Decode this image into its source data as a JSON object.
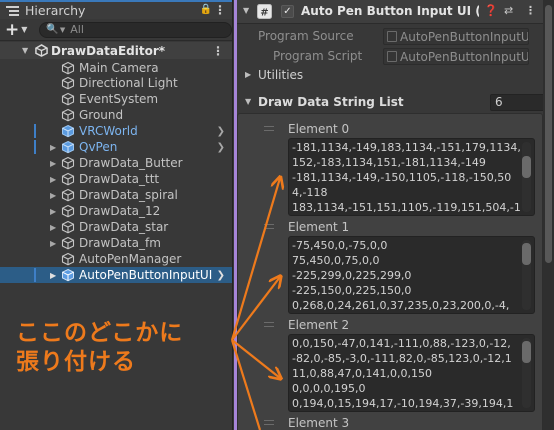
{
  "hierarchy": {
    "tab_title": "Hierarchy",
    "search_placeholder": "All",
    "scene_name": "DrawDataEditor*",
    "items": [
      {
        "label": "Main Camera"
      },
      {
        "label": "Directional Light"
      },
      {
        "label": "EventSystem"
      },
      {
        "label": "Ground"
      },
      {
        "label": "VRCWorld"
      },
      {
        "label": "QvPen"
      },
      {
        "label": "DrawData_Butter"
      },
      {
        "label": "DrawData_ttt"
      },
      {
        "label": "DrawData_spiral"
      },
      {
        "label": "DrawData_12"
      },
      {
        "label": "DrawData_star"
      },
      {
        "label": "DrawData_fm"
      },
      {
        "label": "AutoPenManager"
      },
      {
        "label": "AutoPenButtonInputUI"
      }
    ]
  },
  "inspector": {
    "component_title": "Auto Pen Button Input UI (Scrip",
    "program_source_label": "Program Source",
    "program_source_value": "AutoPenButtonInputUI",
    "program_script_label": "Program Script",
    "program_script_value": "AutoPenButtonInputUI",
    "utilities_label": "Utilities",
    "list_label": "Draw Data String List",
    "list_size": "6",
    "elements": [
      {
        "name": "Element 0",
        "lines": [
          "-181,1134,-149,183,1134,-151,179,1134,",
          "152,-183,1134,151,-181,1134,-149",
          "-181,1134,-149,-150,1105,-118,-150,50",
          "4,-118",
          "183,1134,-151,151,1105,-119,151,504,-1"
        ]
      },
      {
        "name": "Element 1",
        "lines": [
          "-75,450,0,-75,0,0",
          "75,450,0,75,0,0",
          "-225,299,0,225,299,0",
          "-225,150,0,225,150,0",
          "0,268,0,24,261,0,37,235,0,23,200,0,-4,"
        ]
      },
      {
        "name": "Element 2",
        "lines": [
          "0,0,150,-47,0,141,-111,0,88,-123,0,-12,",
          "-82,0,-85,-3,0,-111,82,0,-85,123,0,-12,1",
          "11,0,88,47,0,141,0,0,150",
          "0,0,0,0,195,0",
          "0,194,0,15,194,17,-10,194,37,-39,194,1"
        ]
      },
      {
        "name": "Element 3",
        "lines": []
      }
    ]
  },
  "annotation": {
    "line1": "ここのどこかに",
    "line2": "張り付ける",
    "color": "#ee7a1c"
  },
  "colors": {
    "selection": "#2c5d87",
    "prefab_text": "#7cb4ef",
    "tab_accent": "#3a79bb"
  }
}
